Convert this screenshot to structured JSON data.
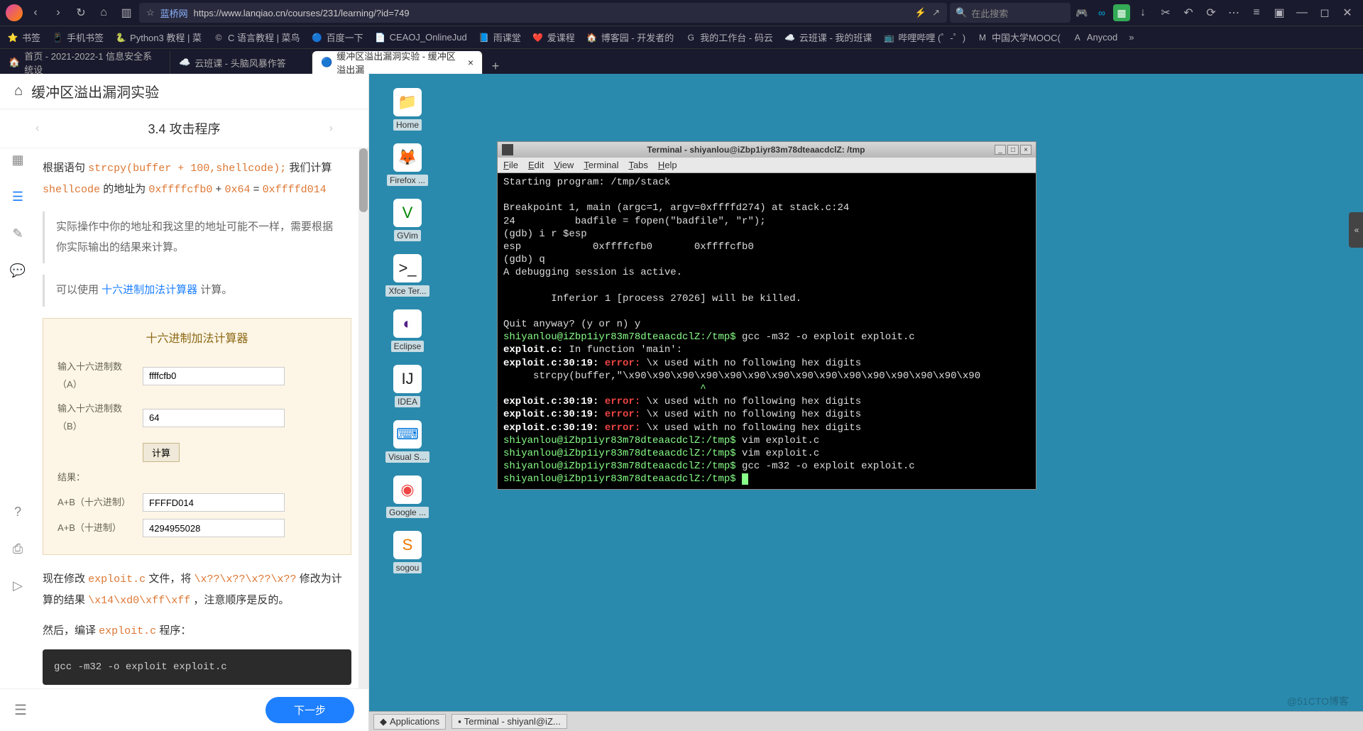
{
  "browser": {
    "site_name": "蓝桥网",
    "url": "https://www.lanqiao.cn/courses/231/learning/?id=749",
    "search_placeholder": "在此搜索"
  },
  "bookmarks": [
    {
      "icon": "⭐",
      "label": "书签"
    },
    {
      "icon": "📱",
      "label": "手机书签"
    },
    {
      "icon": "🐍",
      "label": "Python3 教程 | 菜"
    },
    {
      "icon": "©",
      "label": "C 语言教程 | 菜鸟"
    },
    {
      "icon": "🔵",
      "label": "百度一下"
    },
    {
      "icon": "📄",
      "label": "CEAOJ_OnlineJud"
    },
    {
      "icon": "📘",
      "label": "雨课堂"
    },
    {
      "icon": "❤️",
      "label": "爱课程"
    },
    {
      "icon": "🏠",
      "label": "博客园 - 开发者的"
    },
    {
      "icon": "G",
      "label": "我的工作台 - 码云"
    },
    {
      "icon": "☁️",
      "label": "云班课 - 我的班课"
    },
    {
      "icon": "📺",
      "label": "哔哩哔哩 (゜-゜)"
    },
    {
      "icon": "M",
      "label": "中国大学MOOC("
    },
    {
      "icon": "A",
      "label": "Anycod"
    }
  ],
  "tabs": [
    {
      "icon": "🏠",
      "label": "首页 - 2021-2022-1 信息安全系统设",
      "active": false
    },
    {
      "icon": "☁️",
      "label": "云班课 - 头脑风暴作答",
      "active": false
    },
    {
      "icon": "🔵",
      "label": "缓冲区溢出漏洞实验 - 缓冲区溢出漏",
      "active": true
    }
  ],
  "page": {
    "title": "缓冲区溢出漏洞实验",
    "section": "3.4 攻击程序"
  },
  "lesson": {
    "line1_a": "根据语句 ",
    "line1_code": "strcpy(buffer + 100,shellcode);",
    "line1_b": " 我们计算 ",
    "line2_a": "shellcode",
    "line2_b": " 的地址为 ",
    "hex1": "0xffffcfb0",
    "plus": " + ",
    "hex2": "0x64",
    "eq": " = ",
    "hex3": "0xffffd014",
    "quote1": "实际操作中你的地址和我这里的地址可能不一样，需要根据你实际输出的结果来计算。",
    "quote2a": "可以使用 ",
    "quote2_link": "十六进制加法计算器",
    "quote2b": " 计算。",
    "calc_title": "十六进制加法计算器",
    "calc_labels": {
      "a": "输入十六进制数（A）",
      "b": "输入十六进制数（B）",
      "btn": "计算",
      "result": "结果：",
      "hex_out": "A+B（十六进制）",
      "dec_out": "A+B（十进制）"
    },
    "calc_values": {
      "a": "ffffcfb0",
      "b": "64",
      "hex": "FFFFD014",
      "dec": "4294955028"
    },
    "mod_a": "现在修改 ",
    "mod_file": "exploit.c",
    "mod_b": " 文件，将 ",
    "mod_pat": "\\x??\\x??\\x??\\x??",
    "mod_c": " 修改为计算的结果 ",
    "mod_val": "\\x14\\xd0\\xff\\xff",
    "mod_d": "，注意顺序是反的。",
    "compile_a": "然后，编译 ",
    "compile_b": " 程序：",
    "cmd": "gcc -m32 -o exploit exploit.c",
    "next": "下一步"
  },
  "desktop": [
    {
      "icon": "📁",
      "label": "Home",
      "color": "#6ab"
    },
    {
      "icon": "🦊",
      "label": "Firefox ...",
      "color": "#e60"
    },
    {
      "icon": "V",
      "label": "GVim",
      "color": "#080"
    },
    {
      "icon": ">_",
      "label": "Xfce Ter...",
      "color": "#222"
    },
    {
      "icon": "◐",
      "label": "Eclipse",
      "color": "#528"
    },
    {
      "icon": "IJ",
      "label": "IDEA",
      "color": "#222"
    },
    {
      "icon": "⌨",
      "label": "Visual S...",
      "color": "#07d"
    },
    {
      "icon": "◉",
      "label": "Google ...",
      "color": "#e44"
    },
    {
      "icon": "S",
      "label": "sogou",
      "color": "#e70"
    }
  ],
  "terminal": {
    "title": "Terminal - shiyanlou@iZbp1iyr83m78dteaacdclZ: /tmp",
    "menus": [
      "File",
      "Edit",
      "View",
      "Terminal",
      "Tabs",
      "Help"
    ],
    "prompt_host": "shiyanlou@iZbp1iyr83m78dteaacdclZ:/tmp$",
    "lines": {
      "l1": "Starting program: /tmp/stack",
      "l2": "Breakpoint 1, main (argc=1, argv=0xffffd274) at stack.c:24",
      "l3": "24          badfile = fopen(\"badfile\", \"r\");",
      "l4": "(gdb) i r $esp",
      "l5": "esp            0xffffcfb0       0xffffcfb0",
      "l6": "(gdb) q",
      "l7": "A debugging session is active.",
      "l8": "        Inferior 1 [process 27026] will be killed.",
      "l9": "Quit anyway? (y or n) y",
      "c1": " gcc -m32 -o exploit exploit.c",
      "f1": "exploit.c:",
      "f1b": " In function 'main':",
      "eA": "exploit.c:30:19: ",
      "err": "error:",
      "eB": " \\x used with no following hex digits",
      "strcpy": "     strcpy(buffer,\"\\x90\\x90\\x90\\x90\\x90\\x90\\x90\\x90\\x90\\x90\\x90\\x90\\x90\\x90\\x90",
      "caret": "                                 ^",
      "c2": " vim exploit.c",
      "c3": " vim exploit.c",
      "c4": " gcc -m32 -o exploit exploit.c"
    }
  },
  "taskbar": {
    "apps": "Applications",
    "term": "Terminal - shiyanl@iZ..."
  },
  "watermark": "@51CTO博客"
}
